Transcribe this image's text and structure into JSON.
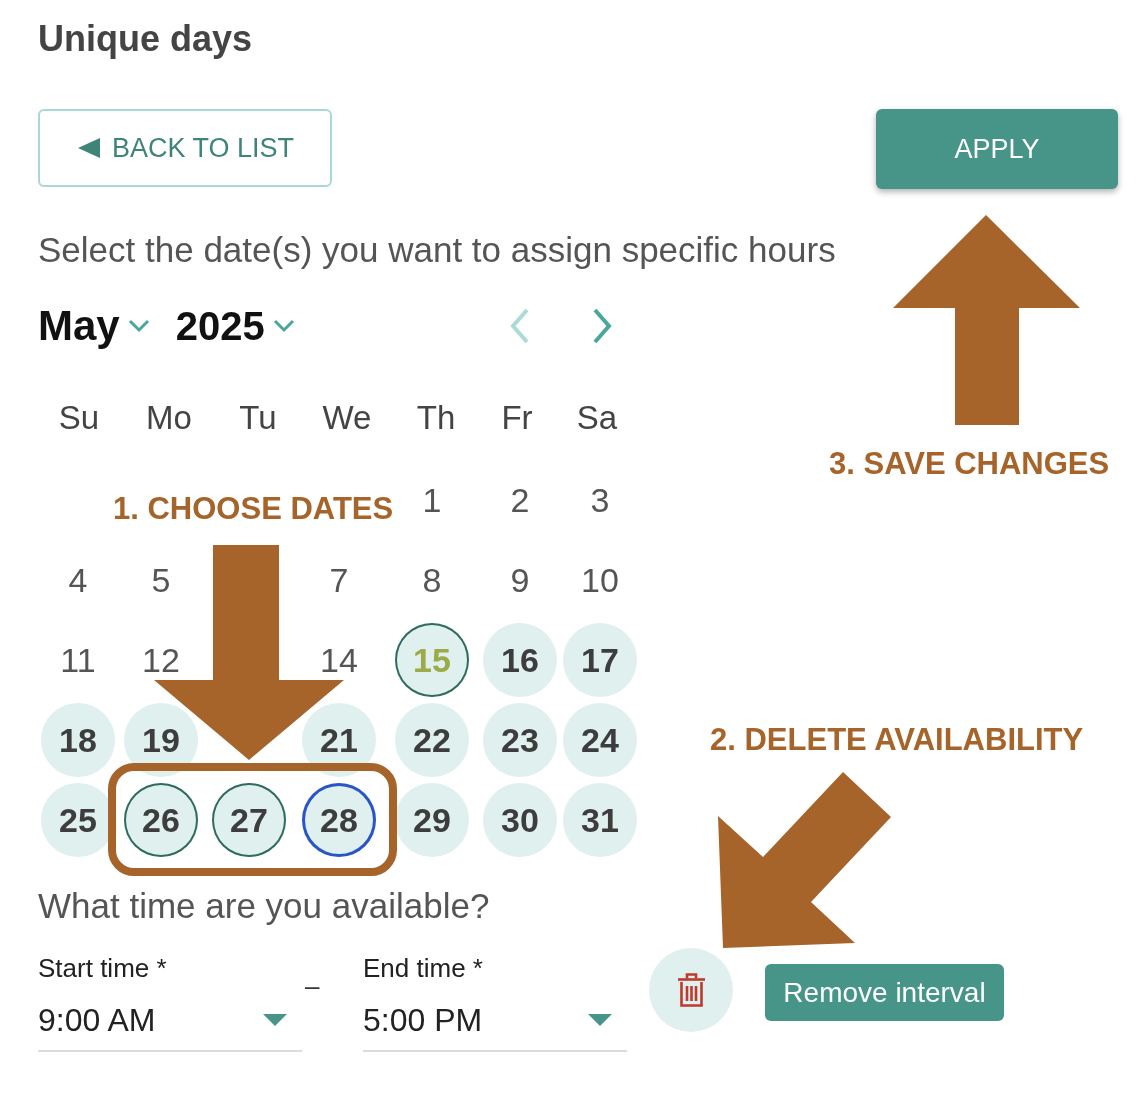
{
  "heading": "Unique days",
  "toolbar": {
    "back_button": {
      "label": "BACK TO LIST"
    },
    "apply_button": {
      "label": "APPLY"
    }
  },
  "instruction": "Select the date(s) you want to assign specific hours",
  "calendar": {
    "month": "May",
    "year": "2025",
    "previous_month": {
      "disabled": true
    },
    "next_month": {
      "disabled": false
    },
    "weekdays": [
      "Su",
      "Mo",
      "Tu",
      "We",
      "Th",
      "Fr",
      "Sa"
    ],
    "weeks": [
      [
        {
          "kind": "blank"
        },
        {
          "kind": "blank"
        },
        {
          "kind": "blank"
        },
        {
          "kind": "blank"
        },
        {
          "kind": "day",
          "day": "1",
          "available": false,
          "selected": false,
          "today": false,
          "focused": false
        },
        {
          "kind": "day",
          "day": "2",
          "available": false,
          "selected": false,
          "today": false,
          "focused": false
        },
        {
          "kind": "day",
          "day": "3",
          "available": false,
          "selected": false,
          "today": false,
          "focused": false
        }
      ],
      [
        {
          "kind": "day",
          "day": "4",
          "available": false,
          "selected": false,
          "today": false,
          "focused": false
        },
        {
          "kind": "day",
          "day": "5",
          "available": false,
          "selected": false,
          "today": false,
          "focused": false
        },
        {
          "kind": "blank"
        },
        {
          "kind": "day",
          "day": "7",
          "available": false,
          "selected": false,
          "today": false,
          "focused": false
        },
        {
          "kind": "day",
          "day": "8",
          "available": false,
          "selected": false,
          "today": false,
          "focused": false
        },
        {
          "kind": "day",
          "day": "9",
          "available": false,
          "selected": false,
          "today": false,
          "focused": false
        },
        {
          "kind": "day",
          "day": "10",
          "available": false,
          "selected": false,
          "today": false,
          "focused": false
        }
      ],
      [
        {
          "kind": "day",
          "day": "11",
          "available": false,
          "selected": false,
          "today": false,
          "focused": false
        },
        {
          "kind": "day",
          "day": "12",
          "available": false,
          "selected": false,
          "today": false,
          "focused": false
        },
        {
          "kind": "blank"
        },
        {
          "kind": "day",
          "day": "14",
          "available": false,
          "selected": false,
          "today": false,
          "focused": false
        },
        {
          "kind": "day",
          "day": "15",
          "available": true,
          "selected": false,
          "today": true,
          "focused": false
        },
        {
          "kind": "day",
          "day": "16",
          "available": true,
          "selected": false,
          "today": false,
          "focused": false
        },
        {
          "kind": "day",
          "day": "17",
          "available": true,
          "selected": false,
          "today": false,
          "focused": false
        }
      ],
      [
        {
          "kind": "day",
          "day": "18",
          "available": true,
          "selected": false,
          "today": false,
          "focused": false
        },
        {
          "kind": "day",
          "day": "19",
          "available": true,
          "selected": false,
          "today": false,
          "focused": false
        },
        {
          "kind": "blank"
        },
        {
          "kind": "day",
          "day": "21",
          "available": true,
          "selected": false,
          "today": false,
          "focused": false
        },
        {
          "kind": "day",
          "day": "22",
          "available": true,
          "selected": false,
          "today": false,
          "focused": false
        },
        {
          "kind": "day",
          "day": "23",
          "available": true,
          "selected": false,
          "today": false,
          "focused": false
        },
        {
          "kind": "day",
          "day": "24",
          "available": true,
          "selected": false,
          "today": false,
          "focused": false
        }
      ],
      [
        {
          "kind": "day",
          "day": "25",
          "available": true,
          "selected": false,
          "today": false,
          "focused": false
        },
        {
          "kind": "day",
          "day": "26",
          "available": true,
          "selected": true,
          "today": false,
          "focused": false
        },
        {
          "kind": "day",
          "day": "27",
          "available": true,
          "selected": true,
          "today": false,
          "focused": false
        },
        {
          "kind": "day",
          "day": "28",
          "available": true,
          "selected": true,
          "today": false,
          "focused": true
        },
        {
          "kind": "day",
          "day": "29",
          "available": true,
          "selected": false,
          "today": false,
          "focused": false
        },
        {
          "kind": "day",
          "day": "30",
          "available": true,
          "selected": false,
          "today": false,
          "focused": false
        },
        {
          "kind": "day",
          "day": "31",
          "available": true,
          "selected": false,
          "today": false,
          "focused": false
        }
      ]
    ]
  },
  "availability": {
    "question": "What time are you available?",
    "start_time": {
      "label": "Start time *",
      "value": "9:00 AM"
    },
    "separator": "–",
    "end_time": {
      "label": "End time *",
      "value": "5:00 PM"
    },
    "remove_button": {
      "label": "Remove interval"
    }
  },
  "annotations": [
    {
      "kind": "up",
      "label": "3. SAVE CHANGES"
    },
    {
      "kind": "down",
      "label": "1. CHOOSE DATES"
    },
    {
      "kind": "diagonal",
      "label": "2. DELETE AVAILABILITY"
    }
  ]
}
